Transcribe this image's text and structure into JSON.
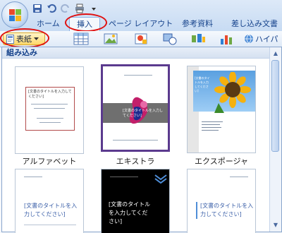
{
  "qat_icons": [
    "save-icon",
    "undo-icon",
    "redo-icon",
    "print-icon",
    "dropdown-icon"
  ],
  "tabs": [
    {
      "label": "ホーム"
    },
    {
      "label": "挿入"
    },
    {
      "label": "ページ レイアウト"
    },
    {
      "label": "参考資料"
    },
    {
      "label": "差し込み文書"
    }
  ],
  "active_tab": "挿入",
  "ribbon": {
    "cover_label": "表紙",
    "hyperlink_label": "ハイパ"
  },
  "gallery": {
    "header": "組み込み",
    "templates": [
      {
        "label": "アルファベット",
        "title_text": "[文書のタイトルを入力してください]"
      },
      {
        "label": "エキストラ",
        "title_text": "[文書のタイトルを入力してください]"
      },
      {
        "label": "エクスポージャ",
        "title_text": "[文書のタイトルを入力してください]"
      },
      {
        "label": "",
        "title_text": "[文書のタイトルを入力してください]"
      },
      {
        "label": "",
        "title_text": "[文書のタイトルを入力してください]"
      },
      {
        "label": "",
        "title_text": "[文書のタイトルを入力してください]"
      }
    ]
  },
  "colors": {
    "highlight_oval": "#e01010",
    "ribbon_blue": "#15428b",
    "extra_border": "#5b3a8e"
  }
}
